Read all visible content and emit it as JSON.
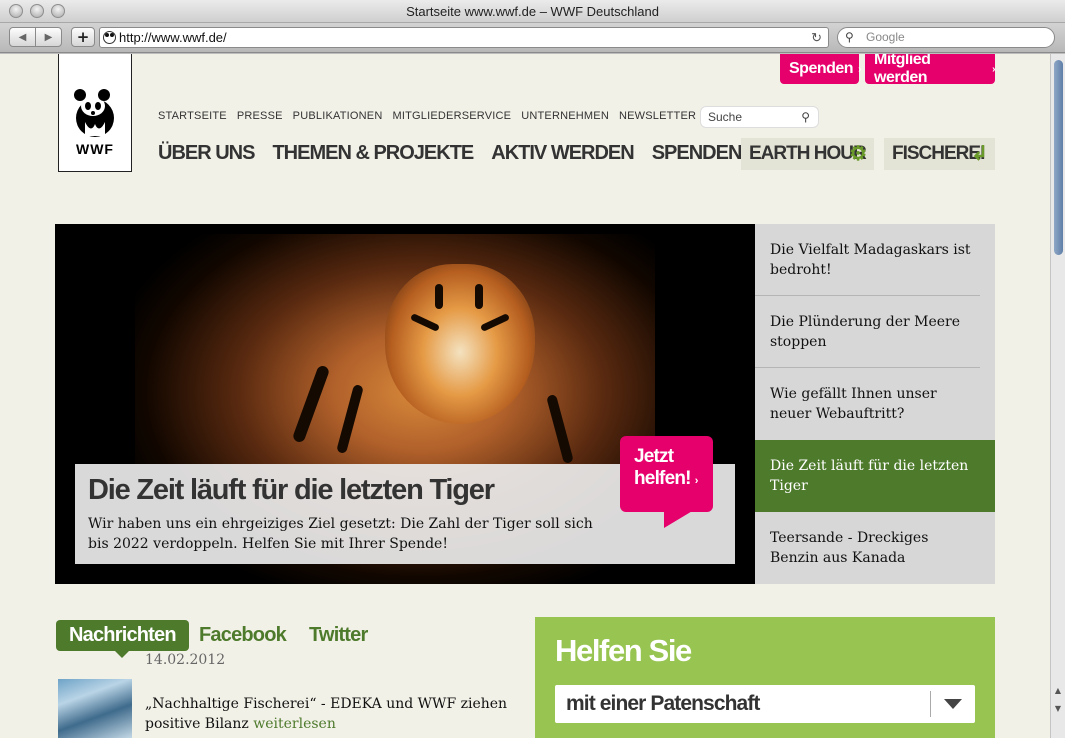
{
  "window": {
    "title": "Startseite www.wwf.de – WWF Deutschland"
  },
  "browser": {
    "url": "http://www.wwf.de/",
    "search_placeholder": "Google",
    "back_glyph": "◀",
    "forward_glyph": "▶",
    "add_glyph": "+",
    "reload_glyph": "↻"
  },
  "site": {
    "logo_text": "WWF",
    "top_buttons": {
      "donate": "Spenden",
      "member": "Mitglied werden",
      "arrow": "›"
    },
    "top_nav": [
      "STARTSEITE",
      "PRESSE",
      "PUBLIKATIONEN",
      "MITGLIEDERSERVICE",
      "UNTERNEHMEN",
      "NEWSLETTER"
    ],
    "search_placeholder": "Suche",
    "main_nav": [
      "ÜBER UNS",
      "THEMEN & PROJEKTE",
      "AKTIV WERDEN",
      "SPENDEN & HELFEN"
    ],
    "special_buttons": {
      "earth_hour": "EARTH HOUR",
      "fischerei": "FISCHEREI"
    }
  },
  "hero": {
    "title": "Die Zeit läuft für die letzten Tiger",
    "text": "Wir haben uns ein ehrgeiziges Ziel gesetzt: Die Zahl der Tiger soll sich bis 2022 verdoppeln. Helfen Sie mit Ihrer Spende!",
    "cta_line1": "Jetzt",
    "cta_line2": "helfen!",
    "cta_arrow": "›"
  },
  "side_items": [
    {
      "label": "Die Vielfalt Madagaskars ist bedroht!"
    },
    {
      "label": "Die Plünderung der Meere stoppen"
    },
    {
      "label": "Wie gefällt Ihnen unser neuer Webauftritt?"
    },
    {
      "label": "Die Zeit läuft für die letzten Tiger"
    },
    {
      "label": "Teersande - Dreckiges Benzin aus Kanada"
    }
  ],
  "tabs": {
    "news": "Nachrichten",
    "facebook": "Facebook",
    "twitter": "Twitter"
  },
  "news": {
    "date": "14.02.2012",
    "title": "„Nachhaltige Fischerei“ - EDEKA und WWF ziehen positive Bilanz",
    "more": "weiterlesen"
  },
  "helfen": {
    "title": "Helfen Sie",
    "selected": "mit einer Patenschaft"
  },
  "colors": {
    "pink": "#e5006b",
    "green": "#4e7a2c",
    "light_green": "#98c452",
    "page_bg": "#f2f1e8"
  }
}
